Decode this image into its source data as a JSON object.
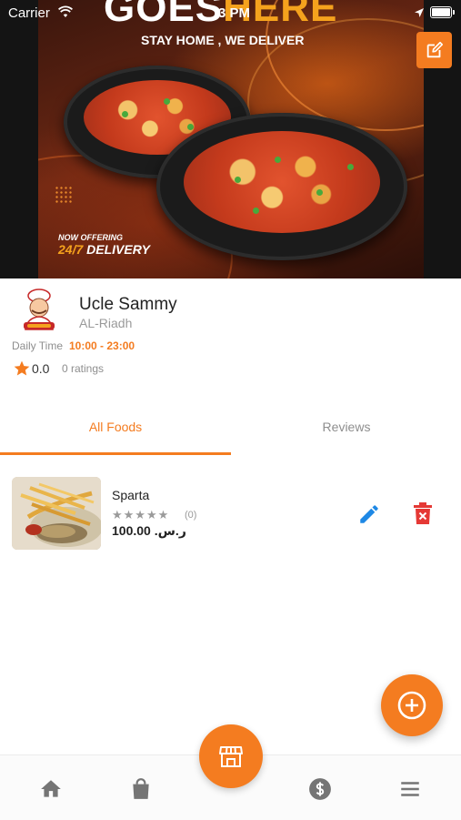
{
  "status_bar": {
    "carrier": "Carrier",
    "time": "3 PM"
  },
  "banner": {
    "headline_white": "GOES",
    "headline_accent": "HERE",
    "tagline": "STAY HOME , WE DELIVER",
    "offer_small": "NOW OFFERING",
    "offer_accent": "24/7",
    "offer_rest": " DELIVERY"
  },
  "restaurant": {
    "name": "Ucle Sammy",
    "city": "AL-Riadh",
    "daily_time_label": "Daily Time",
    "daily_time_value": "10:00 - 23:00",
    "rating": "0.0",
    "ratings_count": "0 ratings"
  },
  "tabs": [
    {
      "label": "All Foods",
      "active": true
    },
    {
      "label": "Reviews",
      "active": false
    }
  ],
  "foods": [
    {
      "name": "Sparta",
      "stars": "★★★★★",
      "reviews": "(0)",
      "price": "100.00 .ر.س"
    }
  ],
  "bottom_nav": {
    "items": [
      "home-icon",
      "shopping-bag-icon",
      "store-icon",
      "dollar-icon",
      "menu-icon"
    ],
    "active": "store-icon"
  },
  "colors": {
    "accent": "#f47c20",
    "edit_blue": "#1e88e5",
    "delete_red": "#e53935"
  }
}
